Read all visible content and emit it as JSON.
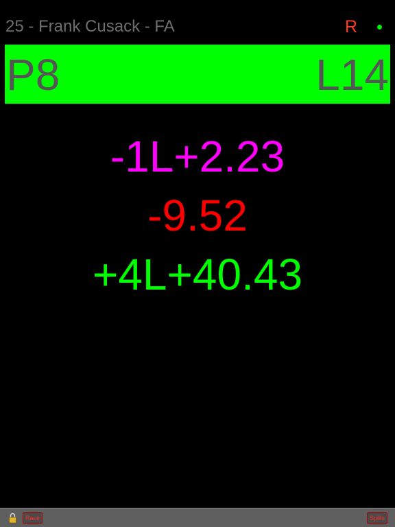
{
  "header": {
    "driver_title": "25 - Frank Cusack - FA",
    "status_letter": "R",
    "status_letter_color": "#ff3b1f",
    "status_dot_color": "#00ee00",
    "lock_icon": "lock-icon"
  },
  "position_bar": {
    "position": "P8",
    "lap": "L14",
    "background_color": "#00ff00"
  },
  "gaps": {
    "ahead": "-1L+2.23",
    "delta": "-9.52",
    "behind": "+4L+40.43",
    "colors": {
      "ahead": "#ff00ff",
      "delta": "#ff0000",
      "behind": "#00ff00"
    }
  },
  "footer": {
    "race_label": "Race",
    "splits_label": "Splits"
  }
}
